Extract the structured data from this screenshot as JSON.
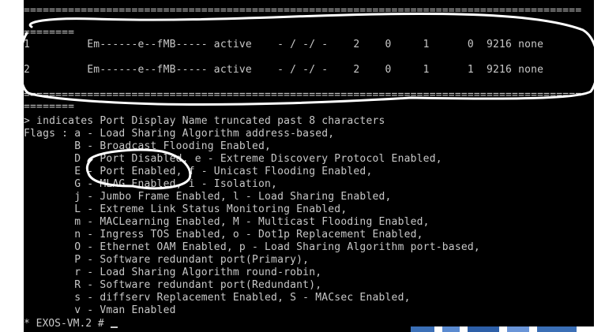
{
  "terminal": {
    "sep_top": "========================================================================================",
    "sep_short_1": "========",
    "rows": [
      {
        "port": "1",
        "flags": "Em------e--fMB-----",
        "state": "active",
        "ls": "- / -/ -",
        "c1": "2",
        "c2": "0",
        "c3": "1",
        "c4": "0",
        "mtu": "9216",
        "desc": "none"
      },
      {
        "port": "2",
        "flags": "Em------e--fMB-----",
        "state": "active",
        "ls": "- / -/ -",
        "c1": "2",
        "c2": "0",
        "c3": "1",
        "c4": "1",
        "mtu": "9216",
        "desc": "none"
      }
    ],
    "sep_mid": "========================================================================================",
    "sep_short_2": "========",
    "note": "> indicates Port Display Name truncated past 8 characters",
    "legend": [
      "Flags : a - Load Sharing Algorithm address-based,",
      "        B - Broadcast Flooding Enabled,",
      "        D - Port Disabled, e - Extreme Discovery Protocol Enabled,",
      "        E - Port Enabled, f - Unicast Flooding Enabled,",
      "        G - MLAG Enabled, i - Isolation,",
      "        j - Jumbo Frame Enabled, l - Load Sharing Enabled,",
      "        L - Extreme Link Status Monitoring Enabled,",
      "        m - MACLearning Enabled, M - Multicast Flooding Enabled,",
      "        n - Ingress TOS Enabled, o - Dot1p Replacement Enabled,",
      "        O - Ethernet OAM Enabled, p - Load Sharing Algorithm port-based,",
      "        P - Software redundant port(Primary),",
      "        r - Load Sharing Algorithm round-robin,",
      "        R - Software redundant port(Redundant),",
      "        s - diffserv Replacement Enabled, S - MACsec Enabled,",
      "        v - Vman Enabled"
    ],
    "prompt": "* EXOS-VM.2 # "
  },
  "colors": {
    "background": "#000000",
    "text": "#c8c8c8",
    "annotation": "#ffffff"
  }
}
